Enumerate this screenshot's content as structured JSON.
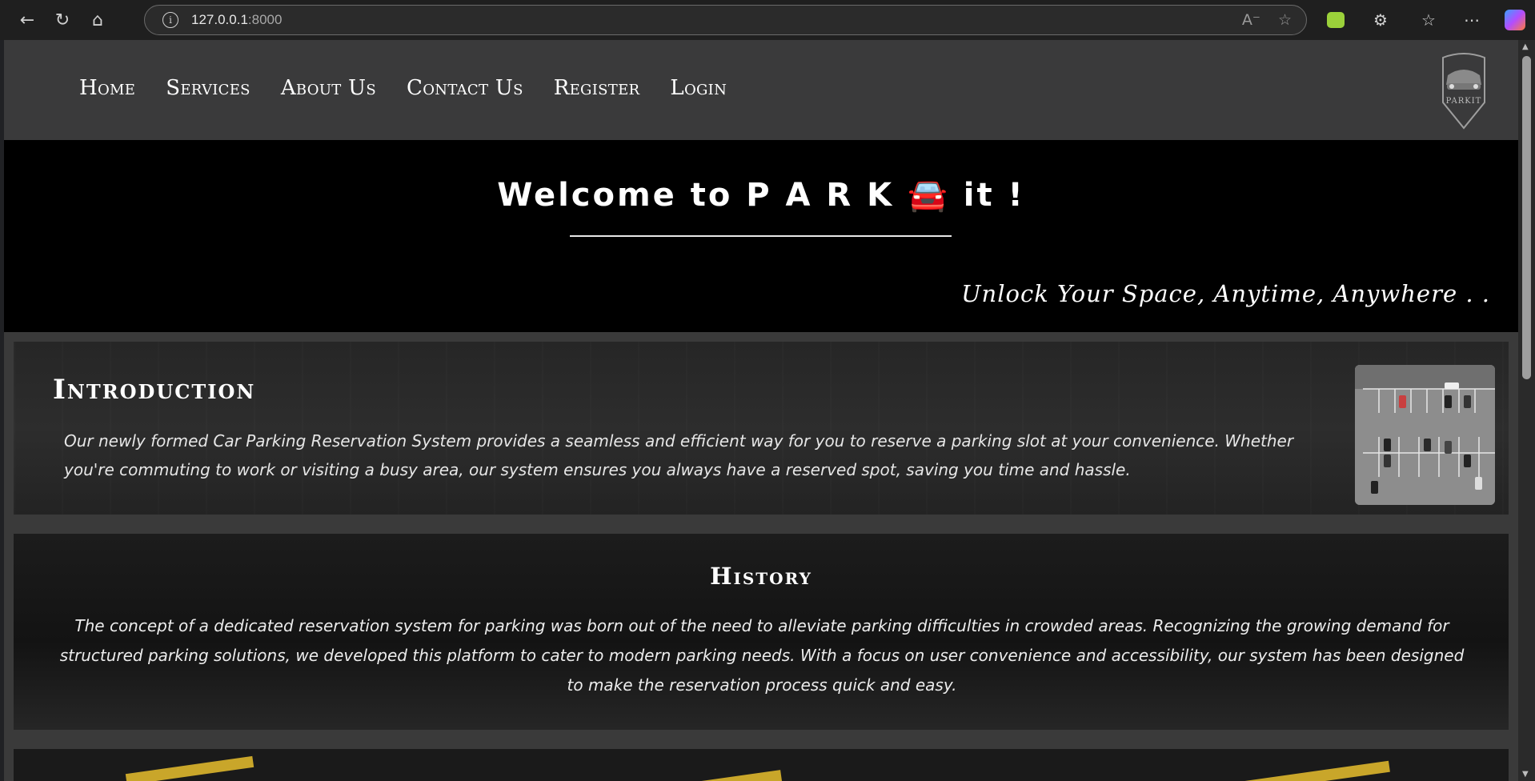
{
  "browser": {
    "url_host": "127.0.0.1",
    "url_port": ":8000"
  },
  "nav": {
    "items": [
      {
        "label": "Home"
      },
      {
        "label": "Services"
      },
      {
        "label": "About Us"
      },
      {
        "label": "Contact Us"
      },
      {
        "label": "Register"
      },
      {
        "label": "Login"
      }
    ],
    "logo_text": "PARKIT"
  },
  "hero": {
    "title": "Welcome to P A R K 🚘 it !",
    "tagline": "Unlock Your Space, Anytime, Anywhere . ."
  },
  "intro": {
    "heading": "Introduction",
    "body": "Our newly formed Car Parking Reservation System provides a seamless and efficient way for you to reserve a parking slot at your convenience. Whether you're commuting to work or visiting a busy area, our system ensures you always have a reserved spot, saving you time and hassle."
  },
  "history": {
    "heading": "History",
    "body": "The concept of a dedicated reservation system for parking was born out of the need to alleviate parking difficulties in crowded areas. Recognizing the growing demand for structured parking solutions, we developed this platform to cater to modern parking needs. With a focus on user convenience and accessibility, our system has been designed to make the reservation process quick and easy."
  },
  "colors": {
    "nav_bg": "#3a3a3b",
    "hero_bg": "#000000",
    "accent_stripe": "#c9a62a"
  },
  "icons": [
    "back-arrow-icon",
    "reload-icon",
    "home-icon",
    "info-icon",
    "read-aloud-icon",
    "favorite-star-icon",
    "extension-icon",
    "favorites-icon",
    "more-icon",
    "copilot-icon",
    "car-icon"
  ]
}
